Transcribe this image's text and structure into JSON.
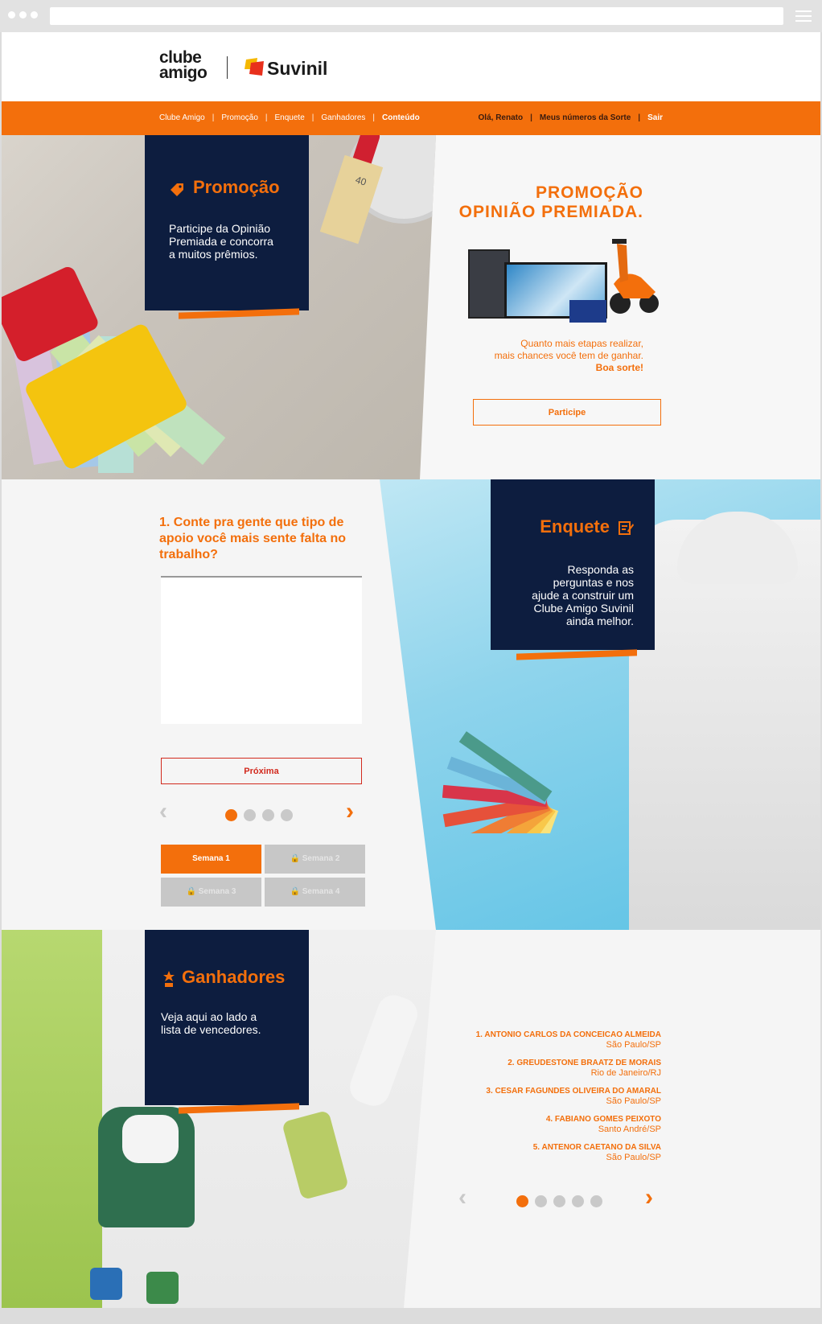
{
  "brand": {
    "logo_line1": "clube",
    "logo_line2": "amigo",
    "partner": "Suvinil",
    "accent": "#f36f0c",
    "navy": "#0d1d3f"
  },
  "nav": {
    "left": [
      "Clube Amigo",
      "Promoção",
      "Enquete",
      "Ganhadores",
      "Conteúdo"
    ],
    "right": [
      "Olá, Renato",
      "Meus números da Sorte",
      "Sair"
    ]
  },
  "promocao": {
    "card_title": "Promoção",
    "card_text_1": "Participe da Opinião",
    "card_text_2": "Premiada e concorra",
    "card_text_3": "a muitos prêmios.",
    "headline_1": "PROMOÇÃO",
    "headline_2": "OPINIÃO PREMIADA.",
    "sub_1": "Quanto mais etapas realizar,",
    "sub_2": "mais chances você tem de ganhar.",
    "sub_3": "Boa sorte!",
    "button": "Participe",
    "brush_number": "40"
  },
  "enquete": {
    "card_title": "Enquete",
    "card_text_1": "Responda as",
    "card_text_2": "perguntas e nos",
    "card_text_3": "ajude a construir um",
    "card_text_4": "Clube Amigo Suvinil",
    "card_text_5": "ainda melhor.",
    "question": "1. Conte pra gente que tipo de apoio você mais sente falta no trabalho?",
    "next_button": "Próxima",
    "pager_total": 4,
    "pager_active": 1,
    "weeks": [
      "Semana 1",
      "Semana 2",
      "Semana 3",
      "Semana 4"
    ]
  },
  "ganhadores": {
    "card_title": "Ganhadores",
    "card_text_1": "Veja aqui ao lado a",
    "card_text_2": "lista de vencedores.",
    "winners": [
      {
        "name": "1. ANTONIO CARLOS DA CONCEICAO ALMEIDA",
        "city": "São Paulo/SP"
      },
      {
        "name": "2. GREUDESTONE BRAATZ DE MORAIS",
        "city": "Rio de Janeiro/RJ"
      },
      {
        "name": "3. CESAR FAGUNDES OLIVEIRA DO AMARAL",
        "city": "São Paulo/SP"
      },
      {
        "name": "4. FABIANO GOMES PEIXOTO",
        "city": "Santo André/SP"
      },
      {
        "name": "5. ANTENOR CAETANO DA SILVA",
        "city": "São Paulo/SP"
      }
    ],
    "pager_total": 5,
    "pager_active": 1
  },
  "icons": {
    "prev": "‹",
    "next": "›",
    "lock": "lock-icon",
    "tag": "tag-icon",
    "note": "note-icon",
    "trophy": "trophy-icon"
  }
}
